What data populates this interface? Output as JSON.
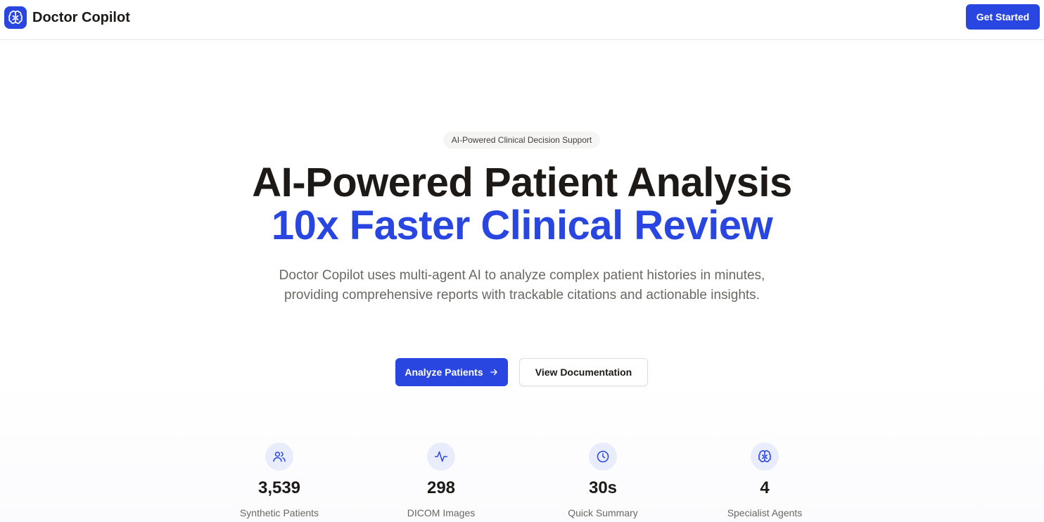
{
  "nav": {
    "brand": "Doctor Copilot",
    "logo_icon": "brain-icon",
    "cta_label": "Get Started"
  },
  "hero": {
    "badge": "AI-Powered Clinical Decision Support",
    "title_line1": "AI-Powered Patient Analysis",
    "title_line2": "10x Faster Clinical Review",
    "description": "Doctor Copilot uses multi-agent AI to analyze complex patient histories in minutes, providing comprehensive reports with trackable citations and actionable insights.",
    "primary_button": "Analyze Patients",
    "primary_button_icon": "arrow-right-icon",
    "secondary_button": "View Documentation"
  },
  "stats": [
    {
      "icon": "users-icon",
      "value": "3,539",
      "label": "Synthetic Patients"
    },
    {
      "icon": "activity-icon",
      "value": "298",
      "label": "DICOM Images"
    },
    {
      "icon": "clock-icon",
      "value": "30s",
      "label": "Quick Summary"
    },
    {
      "icon": "brain-icon",
      "value": "4",
      "label": "Specialist Agents"
    }
  ],
  "colors": {
    "accent": "#2a46e0",
    "text": "#1c1917",
    "muted": "#6b6763",
    "icon_bg": "#e9ecfb"
  }
}
